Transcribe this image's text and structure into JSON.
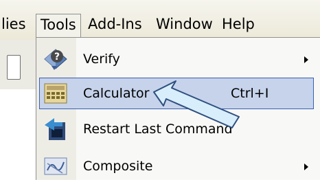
{
  "menubar": {
    "items": [
      {
        "label": "lies"
      },
      {
        "label": "Tools"
      },
      {
        "label": "Add-Ins"
      },
      {
        "label": "Window"
      },
      {
        "label": "Help"
      }
    ]
  },
  "tools_menu": {
    "items": [
      {
        "label": "Verify",
        "has_submenu": true,
        "icon": "verify-icon"
      },
      {
        "label": "Calculator",
        "shortcut": "Ctrl+I",
        "highlighted": true,
        "icon": "calculator-icon"
      },
      {
        "label": "Restart Last Command",
        "icon": "restart-last-command-icon"
      },
      {
        "label": "Composite",
        "has_submenu": true,
        "icon": "composite-icon"
      }
    ]
  },
  "colors": {
    "highlight_fill": "#c6d3eb",
    "highlight_border": "#365fb0",
    "menu_background": "#f8f8f6",
    "menubar_background": "#ece9d8"
  }
}
